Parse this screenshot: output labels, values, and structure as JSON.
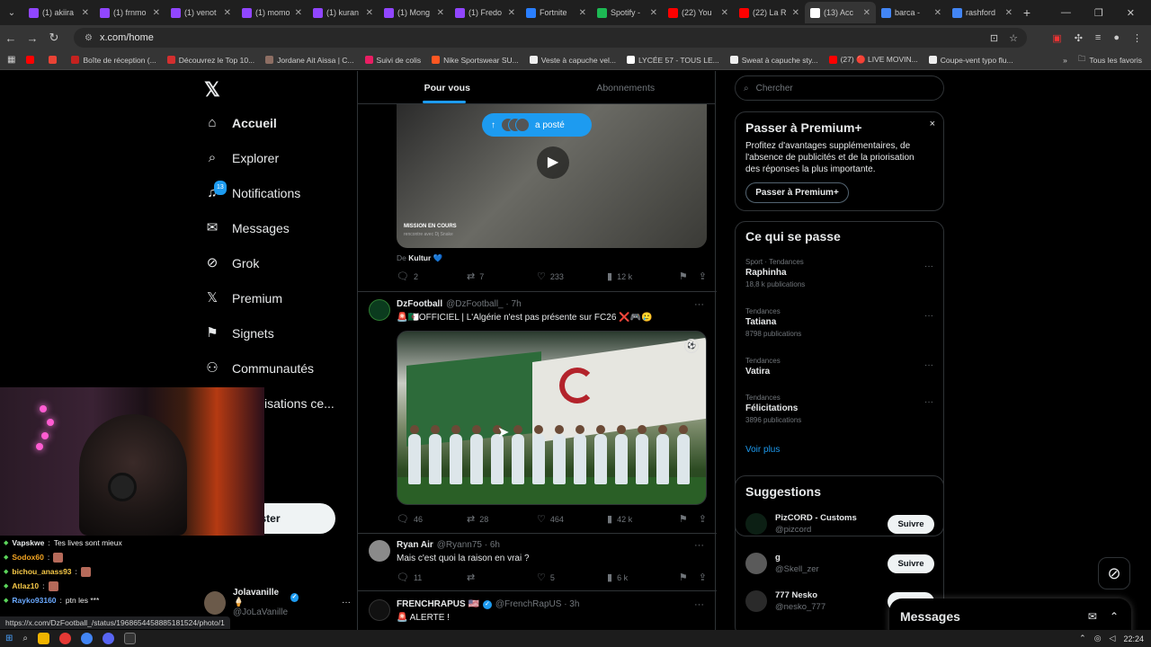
{
  "browser": {
    "tabs": [
      {
        "label": "(1) akiira",
        "color": "#9146ff"
      },
      {
        "label": "(1) frnmo",
        "color": "#9146ff"
      },
      {
        "label": "(1) venot",
        "color": "#9146ff"
      },
      {
        "label": "(1) momo",
        "color": "#9146ff"
      },
      {
        "label": "(1) kuran",
        "color": "#9146ff"
      },
      {
        "label": "(1) Mong",
        "color": "#9146ff"
      },
      {
        "label": "(1) Fredo",
        "color": "#9146ff"
      },
      {
        "label": "Fortnite",
        "color": "#2a7fff"
      },
      {
        "label": "Spotify -",
        "color": "#1db954"
      },
      {
        "label": "(22) You",
        "color": "#ff0000"
      },
      {
        "label": "(22) La R",
        "color": "#ff0000"
      },
      {
        "label": "(13) Acc",
        "color": "#ffffff"
      },
      {
        "label": "barca -",
        "color": "#4285f4"
      },
      {
        "label": "rashford",
        "color": "#4285f4"
      }
    ],
    "new_tab": "+",
    "url": "x.com/home",
    "bookmarks": [
      {
        "label": "",
        "color": "#ff0000"
      },
      {
        "label": "",
        "color": "#ea4335"
      },
      {
        "label": "Boîte de réception (...",
        "color": "#c5221f"
      },
      {
        "label": "Découvrez le Top 10...",
        "color": "#d32f2f"
      },
      {
        "label": "Jordane Ait Aissa | C...",
        "color": "#8d6e63"
      },
      {
        "label": "Suivi de colis",
        "color": "#e91e63"
      },
      {
        "label": "Nike Sportswear SU...",
        "color": "#ff5722"
      },
      {
        "label": "Veste à capuche vel...",
        "color": "#eeeeee"
      },
      {
        "label": "LYCÉE 57 - TOUS LE...",
        "color": "#ffffff"
      },
      {
        "label": "Sweat à capuche sty...",
        "color": "#eeeeee"
      },
      {
        "label": "(27) 🔴 LIVE MOVIN...",
        "color": "#ff0000"
      },
      {
        "label": "Coupe-vent typo flu...",
        "color": "#eeeeee"
      }
    ],
    "all_bookmarks": "Tous les favoris"
  },
  "nav": {
    "items": [
      {
        "label": "Accueil",
        "icon": "home-icon"
      },
      {
        "label": "Explorer",
        "icon": "search-icon"
      },
      {
        "label": "Notifications",
        "icon": "bell-icon",
        "badge": "13"
      },
      {
        "label": "Messages",
        "icon": "mail-icon"
      },
      {
        "label": "Grok",
        "icon": "grok-icon"
      },
      {
        "label": "Premium",
        "icon": "x-icon"
      },
      {
        "label": "Signets",
        "icon": "bookmark-icon"
      },
      {
        "label": "Communautés",
        "icon": "people-icon"
      },
      {
        "label": "isations ce...",
        "icon": ""
      }
    ],
    "post_button": "ster",
    "profile": {
      "name": "Jolavanille 🍦",
      "handle": "@JoLaVanille",
      "more": "···"
    }
  },
  "feed": {
    "tabs": [
      "Pour vous",
      "Abonnements"
    ],
    "posted_pill": "a posté",
    "post1": {
      "overlay_title": "MISSION EN COURS",
      "overlay_sub": "rencontre avec Dj Snake",
      "from_prefix": "De",
      "from_name": "Kultur 💙",
      "replies": "2",
      "reposts": "7",
      "likes": "233",
      "views": "12 k"
    },
    "post2": {
      "name": "DzFootball",
      "handle": "@DzFootball_ · 7h",
      "text": "🚨🇩🇿OFFICIEL | L'Algérie n'est pas présente sur FC26 ❌🎮🥲",
      "replies": "46",
      "reposts": "28",
      "likes": "464",
      "views": "42 k"
    },
    "post3": {
      "name": "Ryan Air",
      "handle": "@Ryann75 · 6h",
      "text": "Mais c'est quoi la raison en vrai ?",
      "replies": "11",
      "reposts": "",
      "likes": "5",
      "views": "6 k"
    },
    "post4": {
      "name": "FRENCHRAPUS 🇺🇸",
      "handle": "@FrenchRapUS · 3h",
      "text": "🚨 ALERTE !"
    },
    "more": "···"
  },
  "sidebar": {
    "search_placeholder": "Chercher",
    "premium": {
      "title": "Passer à Premium+",
      "text": "Profitez d'avantages supplémentaires, de l'absence de publicités et de la priorisation des réponses la plus importante.",
      "button": "Passer à Premium+",
      "close": "×"
    },
    "trends": {
      "title": "Ce qui se passe",
      "items": [
        {
          "category": "Sport · Tendances",
          "name": "Raphinha",
          "count": "18,8 k publications"
        },
        {
          "category": "Tendances",
          "name": "Tatiana",
          "count": "8798 publications"
        },
        {
          "category": "Tendances",
          "name": "Vatira",
          "count": ""
        },
        {
          "category": "Tendances",
          "name": "Félicitations",
          "count": "3896 publications"
        }
      ],
      "more": "···",
      "show_more": "Voir plus"
    },
    "suggestions": {
      "title": "Suggestions",
      "items": [
        {
          "name": "PizCORD - Customs",
          "handle": "@pizcord",
          "button": "Suivre"
        },
        {
          "name": "g",
          "handle": "@Skell_zer",
          "button": "Suivre"
        },
        {
          "name": "777 Nesko",
          "handle": "@nesko_777",
          "button": ""
        }
      ]
    }
  },
  "messages_drawer": {
    "title": "Messages"
  },
  "chat": {
    "lines": [
      {
        "user": "Vapskwe",
        "text": "Tes lives sont mieux",
        "color": "#e7e9ea"
      },
      {
        "user": "Sodox60",
        "text": "",
        "color": "#f5a623"
      },
      {
        "user": "bichou_anass93",
        "text": "",
        "color": "#f7c948"
      },
      {
        "user": "Atlaz10",
        "text": "",
        "color": "#f7c948"
      },
      {
        "user": "Rayko93160",
        "text": "ptn les ***",
        "color": "#6aa9ff"
      }
    ]
  },
  "status_url": "https://x.com/DzFootball_/status/1968654458885181524/photo/1",
  "taskbar": {
    "time": "22:24"
  }
}
